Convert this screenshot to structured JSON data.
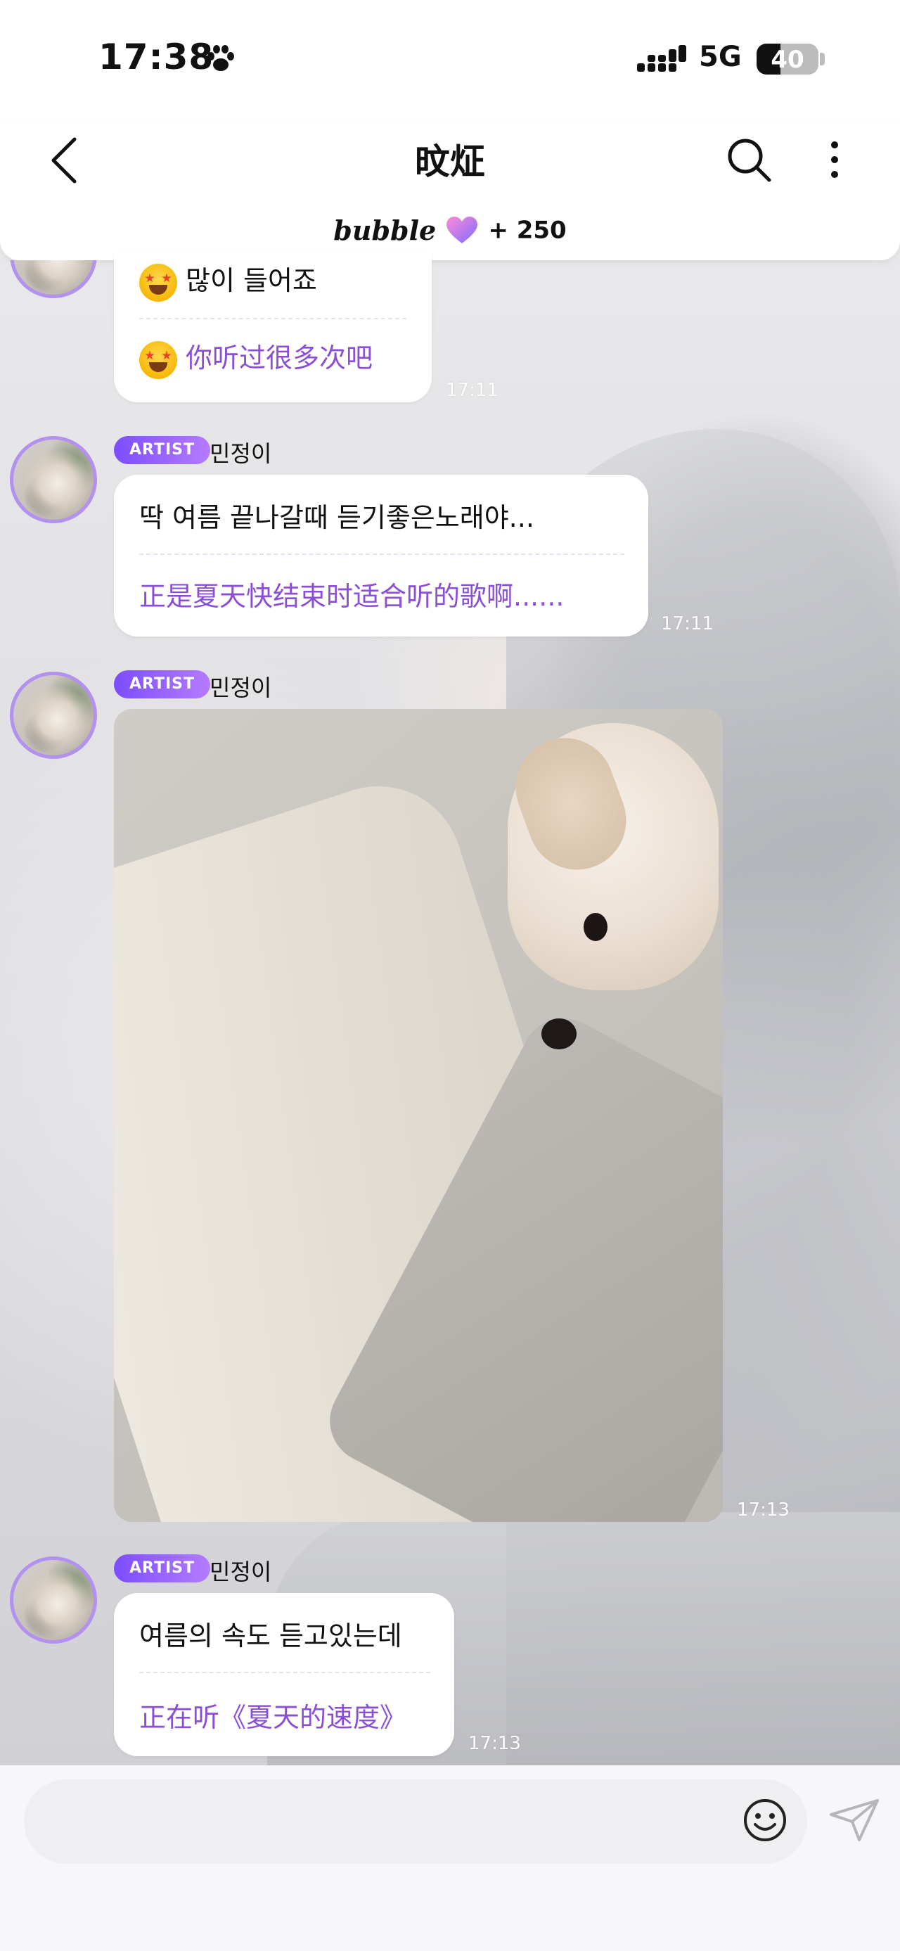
{
  "status_bar": {
    "time": "17:38",
    "network": "5G",
    "battery": "40"
  },
  "header": {
    "title": "旼炡",
    "bubble_logo": "bubble",
    "bubble_count": "+ 250",
    "icons": [
      "back-icon",
      "search-icon",
      "more-vertical-icon",
      "heart-icon"
    ]
  },
  "colors": {
    "accent_purple": "#8a4fd6",
    "badge_gradient_start": "#7c4dff",
    "badge_gradient_end": "#b57bff",
    "avatar_ring": "#b391ef"
  },
  "messages": [
    {
      "korean": "많이 들어죠",
      "chinese": "你听过很多次吧",
      "time": "17:11"
    },
    {
      "badge": "ARTIST",
      "sender": "민정이",
      "korean": "딱 여름 끝나갈때 듣기좋은노래야...",
      "chinese": "正是夏天快结束时适合听的歌啊......",
      "time": "17:11"
    },
    {
      "badge": "ARTIST",
      "sender": "민정이",
      "type": "photo",
      "time": "17:13"
    },
    {
      "badge": "ARTIST",
      "sender": "민정이",
      "korean": "여름의 속도 듣고있는데",
      "chinese": "正在听《夏天的速度》",
      "time": "17:13"
    }
  ],
  "input": {
    "placeholder": "",
    "icons": [
      "emoji-icon",
      "send-icon"
    ]
  }
}
